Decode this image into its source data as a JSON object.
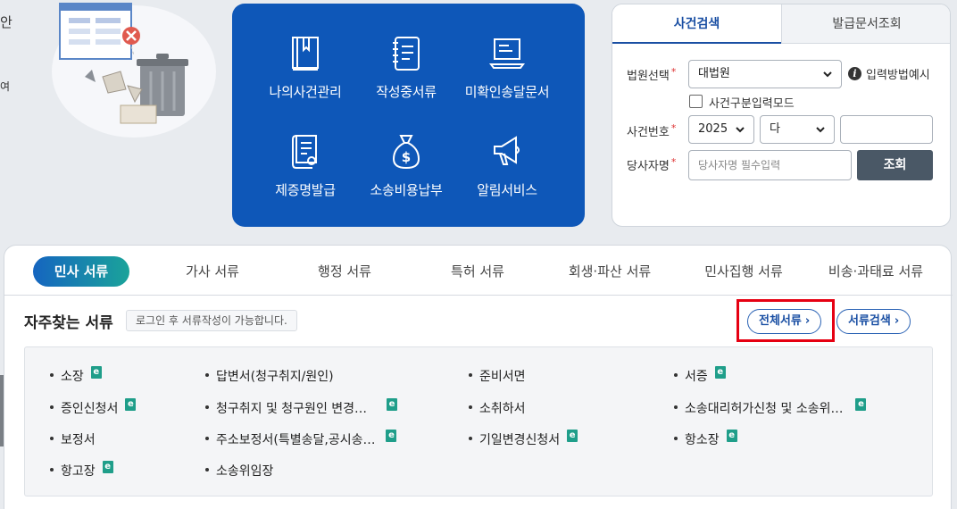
{
  "left_edge": {
    "top_char": "안",
    "mid_char": "여"
  },
  "services": [
    {
      "icon": "book-icon",
      "label": "나의사건관리"
    },
    {
      "icon": "notebook-icon",
      "label": "작성중서류"
    },
    {
      "icon": "laptop-icon",
      "label": "미확인송달문서"
    },
    {
      "icon": "certificate-icon",
      "label": "제증명발급"
    },
    {
      "icon": "money-bag-icon",
      "label": "소송비용납부"
    },
    {
      "icon": "megaphone-icon",
      "label": "알림서비스"
    }
  ],
  "search": {
    "tabs": [
      "사건검색",
      "발급문서조회"
    ],
    "court_label": "법원선택",
    "court_value": "대법원",
    "help_text": "입력방법예시",
    "separate_mode_label": "사건구분입력모드",
    "case_no_label": "사건번호",
    "year_value": "2025",
    "type_value": "다",
    "party_label": "당사자명",
    "party_placeholder": "당사자명 필수입력",
    "search_button": "조회"
  },
  "doc_tabs": [
    "민사 서류",
    "가사 서류",
    "행정 서류",
    "특허 서류",
    "회생·파산 서류",
    "민사집행 서류",
    "비송·과태료 서류"
  ],
  "frequent": {
    "title": "자주찾는 서류",
    "note": "로그인 후 서류작성이 가능합니다.",
    "all_docs_button": "전체서류",
    "doc_search_button": "서류검색",
    "e_badge": "e"
  },
  "documents": [
    {
      "label": "소장",
      "e": true
    },
    {
      "label": "답변서(청구취지/원인)",
      "e": false
    },
    {
      "label": "준비서면",
      "e": false
    },
    {
      "label": "서증",
      "e": true
    },
    {
      "label": "증인신청서",
      "e": true
    },
    {
      "label": "청구취지 및 청구원인 변경…",
      "e": true
    },
    {
      "label": "소취하서",
      "e": false
    },
    {
      "label": "소송대리허가신청 및 소송위…",
      "e": true
    },
    {
      "label": "보정서",
      "e": false
    },
    {
      "label": "주소보정서(특별송달,공시송…",
      "e": true
    },
    {
      "label": "기일변경신청서",
      "e": true
    },
    {
      "label": "항소장",
      "e": true
    },
    {
      "label": "항고장",
      "e": true
    },
    {
      "label": "소송위임장",
      "e": false
    }
  ],
  "colors": {
    "panel_blue": "#0e57b8",
    "accent_blue": "#1a4fa3",
    "highlight_red": "#e60012",
    "e_badge": "#1f9e8a"
  }
}
